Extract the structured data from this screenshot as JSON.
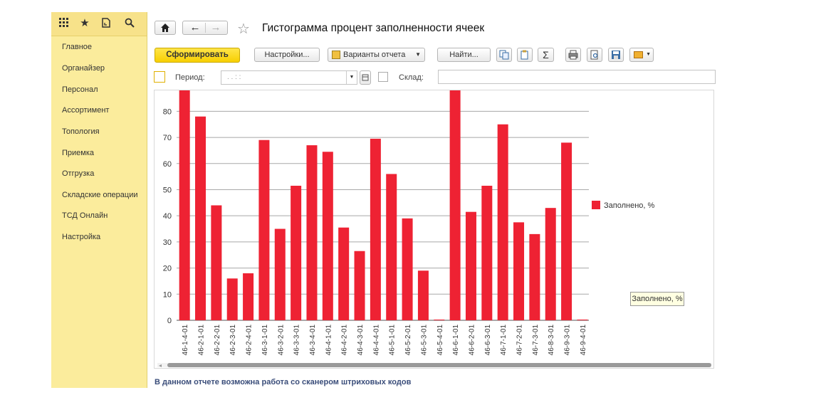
{
  "sidebar": {
    "items": [
      {
        "label": "Главное"
      },
      {
        "label": "Органайзер"
      },
      {
        "label": "Персонал"
      },
      {
        "label": "Ассортимент"
      },
      {
        "label": "Топология"
      },
      {
        "label": "Приемка"
      },
      {
        "label": "Отгрузка"
      },
      {
        "label": "Складские операции"
      },
      {
        "label": "ТСД Онлайн"
      },
      {
        "label": "Настройка"
      }
    ]
  },
  "header": {
    "title": "Гистограмма процент заполненности ячеек"
  },
  "toolbar": {
    "generate_label": "Сформировать",
    "settings_label": "Настройки...",
    "variants_label": "Варианты отчета",
    "find_label": "Найти..."
  },
  "filters": {
    "period_label": "Период:",
    "period_value": ".  .       :  :",
    "warehouse_label": "Склад:"
  },
  "chart_data": {
    "type": "bar",
    "categories": [
      "46-1-4-01",
      "46-2-1-01",
      "46-2-2-01",
      "46-2-3-01",
      "46-2-4-01",
      "46-3-1-01",
      "46-3-2-01",
      "46-3-3-01",
      "46-3-4-01",
      "46-4-1-01",
      "46-4-2-01",
      "46-4-3-01",
      "46-4-4-01",
      "46-5-1-01",
      "46-5-2-01",
      "46-5-3-01",
      "46-5-4-01",
      "46-6-1-01",
      "46-6-2-01",
      "46-6-3-01",
      "46-7-1-01",
      "46-7-2-01",
      "46-7-3-01",
      "46-8-3-01",
      "46-9-3-01",
      "46-9-4-01"
    ],
    "series": [
      {
        "name": "Заполнено, %",
        "color": "#ee2233",
        "values": [
          88,
          78,
          44,
          16,
          18,
          69,
          35,
          51.5,
          67,
          64.5,
          35.5,
          26.5,
          69.5,
          56,
          39,
          19,
          0,
          88,
          41.5,
          51.5,
          75,
          37.5,
          33,
          43,
          68,
          0
        ]
      }
    ],
    "yticks": [
      0,
      10,
      20,
      30,
      40,
      50,
      60,
      70,
      80
    ],
    "ylim": [
      0,
      88
    ],
    "grid": true,
    "legend_position": "right"
  },
  "tooltip": "Заполнено, %",
  "footer": {
    "text": "В данном отчете возможна работа со сканером штриховых кодов"
  }
}
